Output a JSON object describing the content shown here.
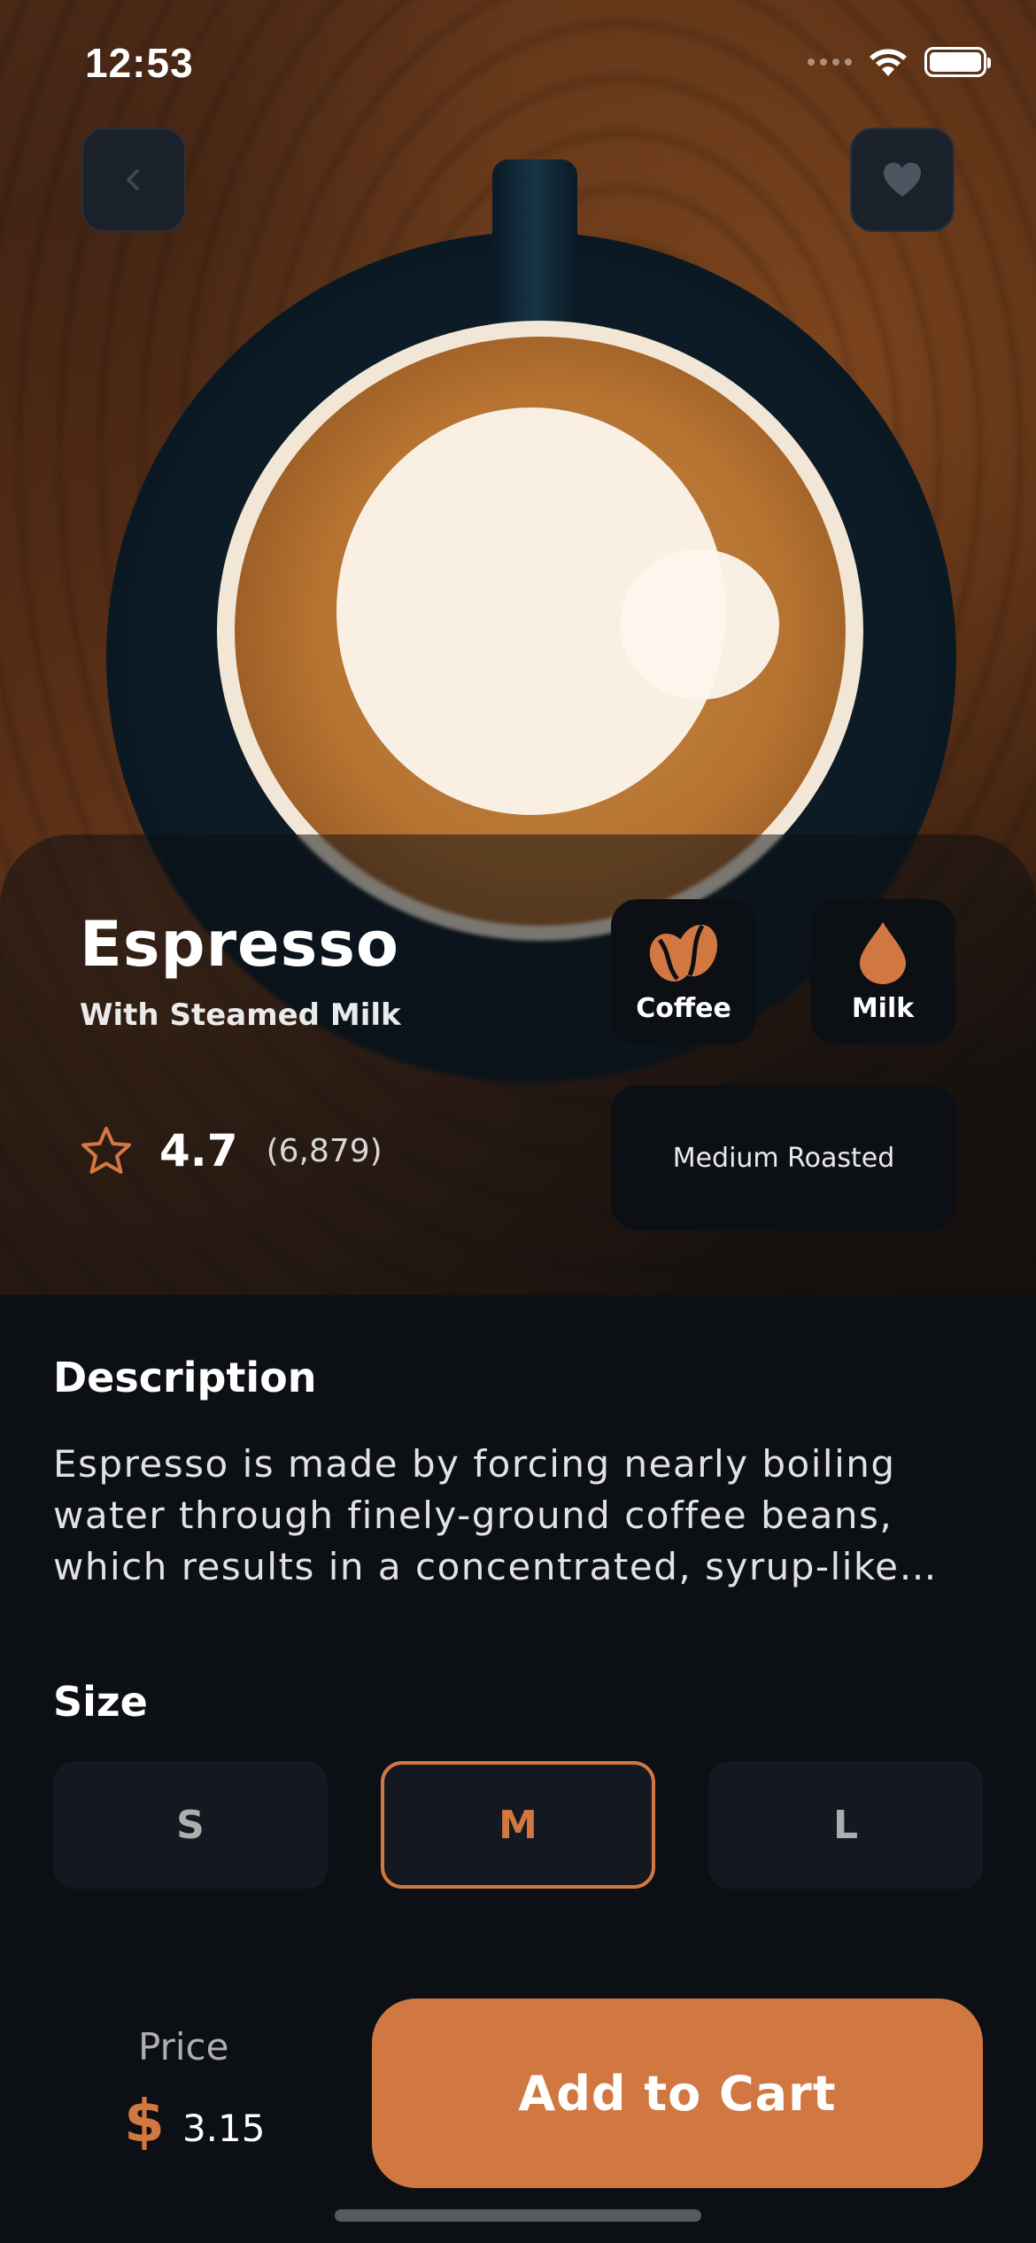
{
  "status_bar": {
    "time": "12:53"
  },
  "product": {
    "name": "Espresso",
    "subtitle": "With Steamed Milk",
    "rating": "4.7",
    "rating_count": "(6,879)",
    "chips": [
      {
        "label": "Coffee",
        "icon": "coffee-beans-icon"
      },
      {
        "label": "Milk",
        "icon": "milk-drop-icon"
      }
    ],
    "roast": "Medium Roasted"
  },
  "description": {
    "title": "Description",
    "text": "Espresso is made by forcing nearly boiling water through finely-ground coffee beans, which results in a concentrated, syrup-like co…"
  },
  "size": {
    "title": "Size",
    "options": [
      "S",
      "M",
      "L"
    ],
    "selected": "M"
  },
  "price": {
    "label": "Price",
    "currency": "$",
    "value": "3.15"
  },
  "cart": {
    "button_label": "Add to Cart"
  },
  "colors": {
    "accent": "#D17842",
    "background": "#0C0F14",
    "surface": "#141921"
  }
}
